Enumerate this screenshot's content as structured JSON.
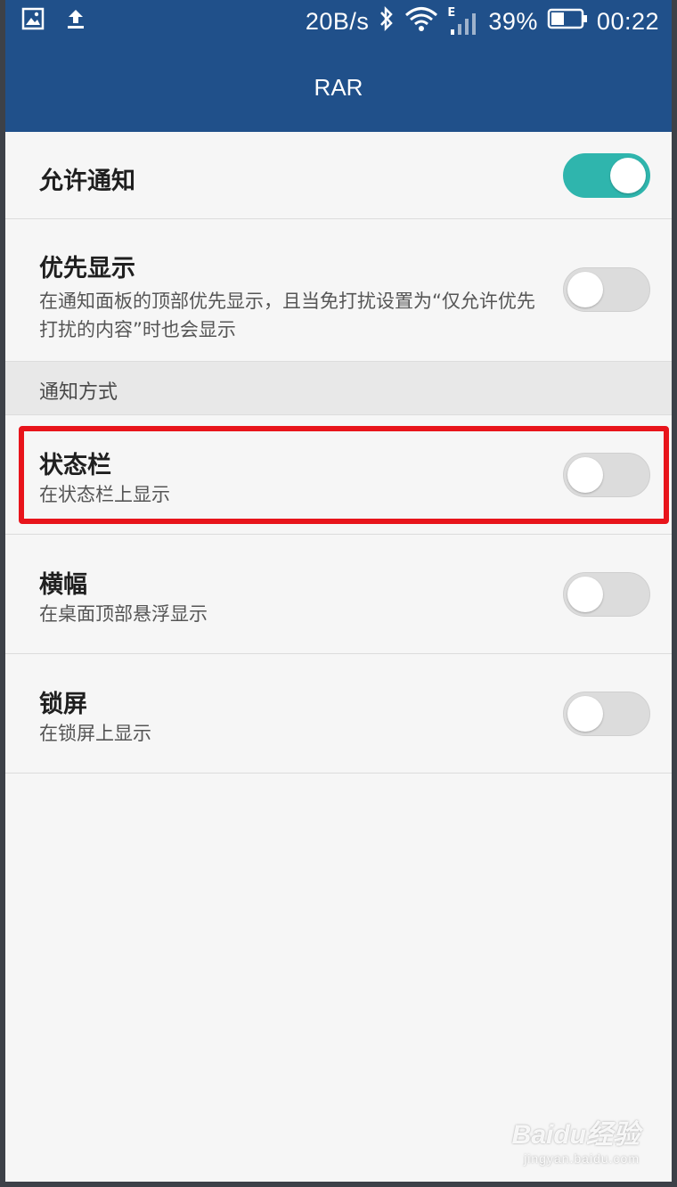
{
  "status_bar": {
    "net_speed": "20B/s",
    "network_type": "E",
    "battery": "39%",
    "time": "00:22",
    "icons": [
      "image-icon",
      "upload-icon",
      "bluetooth-icon",
      "wifi-icon",
      "signal-icon",
      "battery-icon"
    ]
  },
  "app_bar": {
    "title": "RAR"
  },
  "settings": {
    "allow_notify": {
      "title": "允许通知",
      "enabled": true
    },
    "priority": {
      "title": "优先显示",
      "description": "在通知面板的顶部优先显示，且当免打扰设置为“仅允许优先打扰的内容”时也会显示",
      "enabled": false
    },
    "section_header": "通知方式",
    "status_bar_item": {
      "title": "状态栏",
      "description": "在状态栏上显示",
      "enabled": false
    },
    "banner": {
      "title": "横幅",
      "description": "在桌面顶部悬浮显示",
      "enabled": false
    },
    "lock_screen": {
      "title": "锁屏",
      "description": "在锁屏上显示",
      "enabled": false
    }
  },
  "watermark": {
    "brand": "Baidu经验",
    "url": "jingyan.baidu.com"
  },
  "colors": {
    "header": "#20508a",
    "toggle_on": "#2fb5ad",
    "highlight": "#e8141b"
  }
}
